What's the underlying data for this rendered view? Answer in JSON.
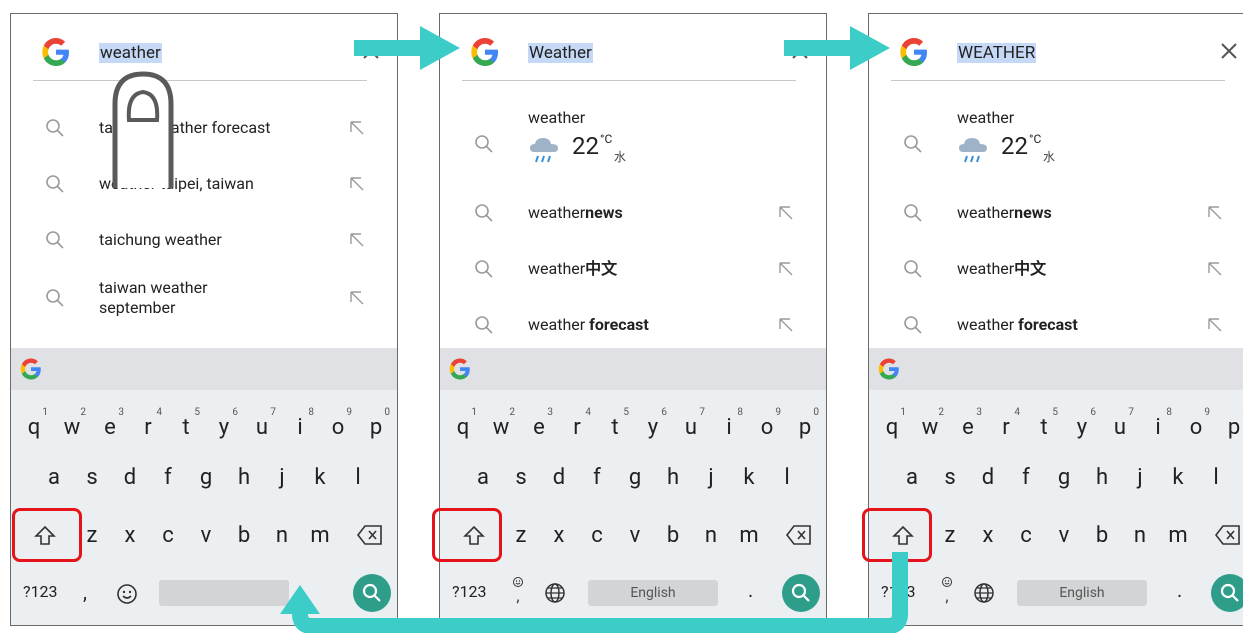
{
  "colors": {
    "highlight": "#c5d9f7",
    "red_box": "#e4141a",
    "arrow": "#3ccdc8",
    "search_key": "#2e9e8b",
    "keyboard_bg": "#eceff1",
    "strip_bg": "#dfe1e5"
  },
  "panels": [
    {
      "query": "weather",
      "close_icon": "close-icon",
      "suggestions": [
        {
          "text": "taiwan weather forecast",
          "icon": "search-icon"
        },
        {
          "text": "weather taipei, taiwan",
          "icon": "search-icon"
        },
        {
          "text": "taichung weather",
          "icon": "search-icon"
        },
        {
          "text": "taiwan weather\nseptember",
          "icon": "search-icon"
        }
      ],
      "keyboard": {
        "k123": "?123",
        "comma": ",",
        "space": ""
      }
    },
    {
      "query": "Weather",
      "weather": {
        "label": "weather",
        "temp": "22",
        "unit": "°C",
        "day": "水"
      },
      "suggestions": [
        {
          "plain": "weather",
          "bold": "news"
        },
        {
          "plain": "weather",
          "bold": "中文"
        },
        {
          "plain": "weather ",
          "bold": "forecast"
        }
      ],
      "keyboard": {
        "k123": "?123",
        "period": ".",
        "space": "English"
      }
    },
    {
      "query": "WEATHER",
      "weather": {
        "label": "weather",
        "temp": "22",
        "unit": "°C",
        "day": "水"
      },
      "suggestions": [
        {
          "plain": "weather",
          "bold": "news"
        },
        {
          "plain": "weather",
          "bold": "中文"
        },
        {
          "plain": "weather ",
          "bold": "forecast"
        }
      ],
      "keyboard": {
        "k123": "?123",
        "period": ".",
        "space": "English"
      }
    }
  ],
  "keys": {
    "row1": [
      "q",
      "w",
      "e",
      "r",
      "t",
      "y",
      "u",
      "i",
      "o",
      "p"
    ],
    "row1_nums": [
      "1",
      "2",
      "3",
      "4",
      "5",
      "6",
      "7",
      "8",
      "9",
      "0"
    ],
    "row2": [
      "a",
      "s",
      "d",
      "f",
      "g",
      "h",
      "j",
      "k",
      "l"
    ],
    "row3": [
      "z",
      "x",
      "c",
      "v",
      "b",
      "n",
      "m"
    ]
  }
}
